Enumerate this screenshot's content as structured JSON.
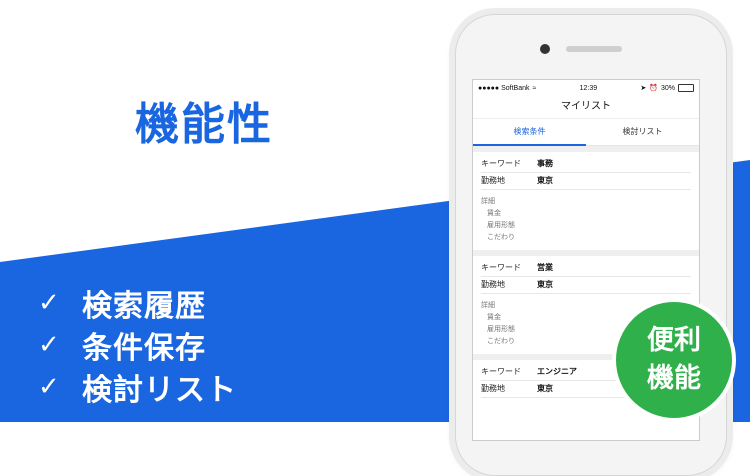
{
  "colors": {
    "brand_blue": "#1a66e0",
    "badge_green": "#2fb04a"
  },
  "headline": "機能性",
  "features": [
    {
      "icon": "check-icon",
      "check": "✓",
      "text": "検索履歴"
    },
    {
      "icon": "check-icon",
      "check": "✓",
      "text": "条件保存"
    },
    {
      "icon": "check-icon",
      "check": "✓",
      "text": "検討リスト"
    }
  ],
  "phone": {
    "status": {
      "carrier": "●●●●● SoftBank",
      "time": "12:39",
      "battery": "30%"
    },
    "title": "マイリスト",
    "tabs": [
      {
        "label": "検索条件"
      },
      {
        "label": "検討リスト"
      }
    ],
    "cards": [
      {
        "keyword_label": "キーワード",
        "keyword": "事務",
        "location_label": "勤務地",
        "location": "東京",
        "details": "詳細",
        "wage": "賃金",
        "employment": "雇用形態",
        "preference": "こだわり"
      },
      {
        "keyword_label": "キーワード",
        "keyword": "営業",
        "location_label": "勤務地",
        "location": "東京",
        "details": "詳細",
        "wage": "賃金",
        "employment": "雇用形態",
        "preference": "こだわり"
      },
      {
        "keyword_label": "キーワード",
        "keyword": "エンジニア",
        "location_label": "勤務地",
        "location": "東京"
      }
    ]
  },
  "badge": {
    "line1": "便利",
    "line2": "機能"
  }
}
